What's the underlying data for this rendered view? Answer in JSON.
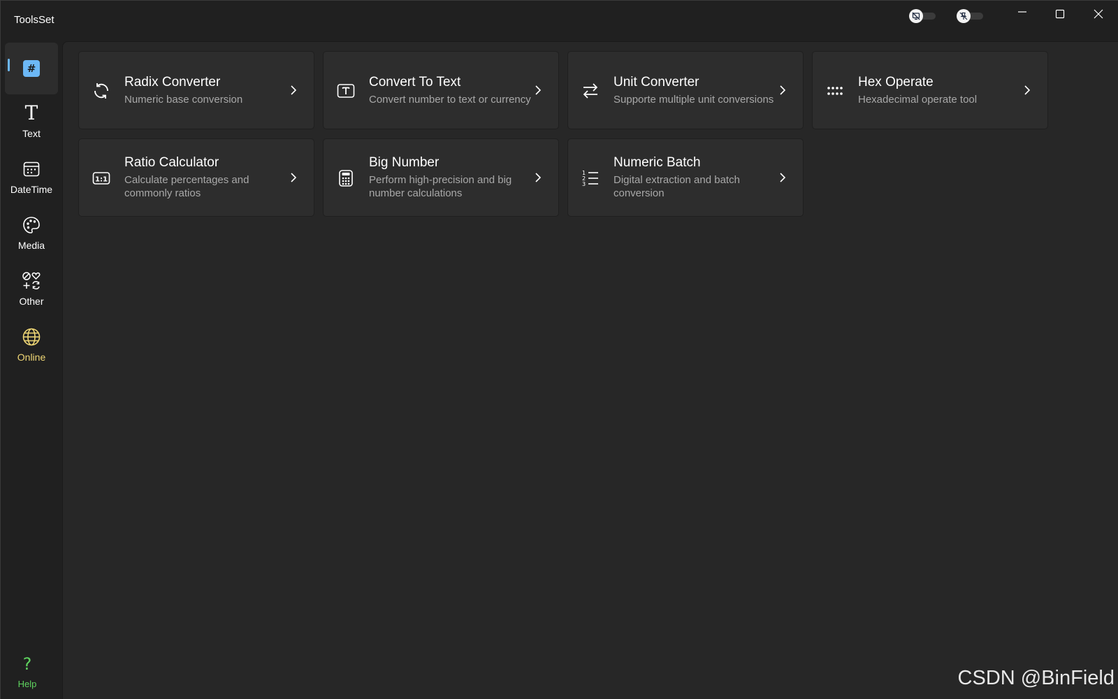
{
  "app": {
    "title": "ToolsSet"
  },
  "sidebar": {
    "items": [
      {
        "id": "number",
        "label": "",
        "icon": "hash-icon"
      },
      {
        "id": "text",
        "label": "Text",
        "icon": "text-icon"
      },
      {
        "id": "datetime",
        "label": "DateTime",
        "icon": "calendar-icon"
      },
      {
        "id": "media",
        "label": "Media",
        "icon": "palette-icon"
      },
      {
        "id": "other",
        "label": "Other",
        "icon": "shapes-icon"
      },
      {
        "id": "online",
        "label": "Online",
        "icon": "globe-icon"
      }
    ],
    "help": {
      "label": "Help",
      "icon": "question-icon"
    }
  },
  "tools": [
    {
      "title": "Radix Converter",
      "description": "Numeric base conversion",
      "icon": "refresh-icon"
    },
    {
      "title": "Convert To Text",
      "description": "Convert number to text or currency",
      "icon": "text-box-icon"
    },
    {
      "title": "Unit Converter",
      "description": "Supporte multiple unit conversions",
      "icon": "swap-arrows-icon"
    },
    {
      "title": "Hex Operate",
      "description": "Hexadecimal operate tool",
      "icon": "dots-grid-icon"
    },
    {
      "title": "Ratio Calculator",
      "description": "Calculate percentages and commonly ratios",
      "icon": "ratio-icon"
    },
    {
      "title": "Big Number",
      "description": "Perform high-precision and big number calculations",
      "icon": "calculator-icon"
    },
    {
      "title": "Numeric Batch",
      "description": "Digital extraction and batch conversion",
      "icon": "numbered-list-icon"
    }
  ],
  "watermark": "CSDN @BinField",
  "colors": {
    "accent": "#6cb8f6",
    "online": "#f0d775",
    "help": "#5fd35f"
  }
}
